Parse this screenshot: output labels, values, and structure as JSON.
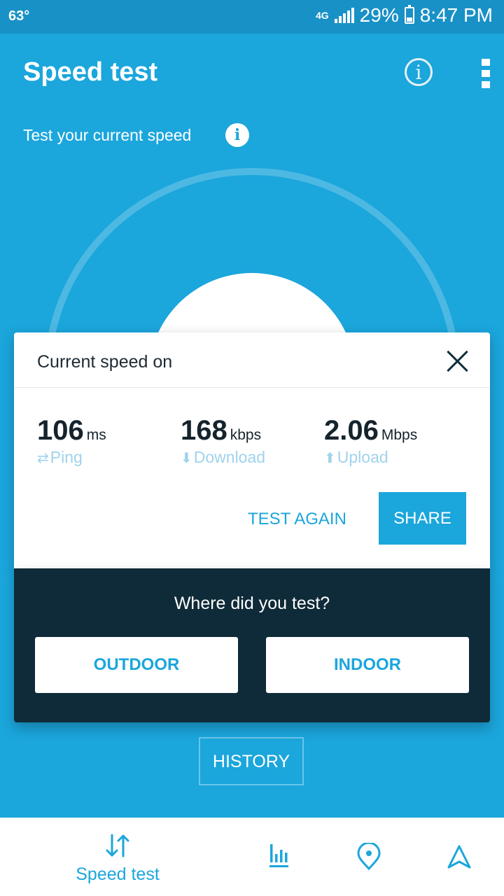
{
  "status_bar": {
    "temperature": "63°",
    "network": "4G",
    "battery": "29%",
    "time": "8:47 PM"
  },
  "app_bar": {
    "title": "Speed test"
  },
  "subtitle": "Test your current speed",
  "result_card": {
    "title": "Current speed on",
    "metrics": [
      {
        "value": "106",
        "unit": "ms",
        "label": "Ping",
        "icon": "ping-arrows-icon"
      },
      {
        "value": "168",
        "unit": "kbps",
        "label": "Download",
        "icon": "download-arrow-icon"
      },
      {
        "value": "2.06",
        "unit": "Mbps",
        "label": "Upload",
        "icon": "upload-arrow-icon"
      }
    ],
    "test_again_label": "TEST AGAIN",
    "share_label": "SHARE"
  },
  "where_panel": {
    "question": "Where did you test?",
    "outdoor_label": "OUTDOOR",
    "indoor_label": "INDOOR"
  },
  "history_label": "HISTORY",
  "bottom_nav": {
    "items": [
      {
        "label": "Speed test",
        "icon": "speed-test-icon",
        "active": true
      },
      {
        "label": "",
        "icon": "bar-chart-icon"
      },
      {
        "label": "",
        "icon": "location-pin-icon"
      },
      {
        "label": "",
        "icon": "navigation-arrow-icon"
      }
    ]
  },
  "colors": {
    "accent": "#1ba6dc",
    "dark_panel": "#0f2a38"
  }
}
